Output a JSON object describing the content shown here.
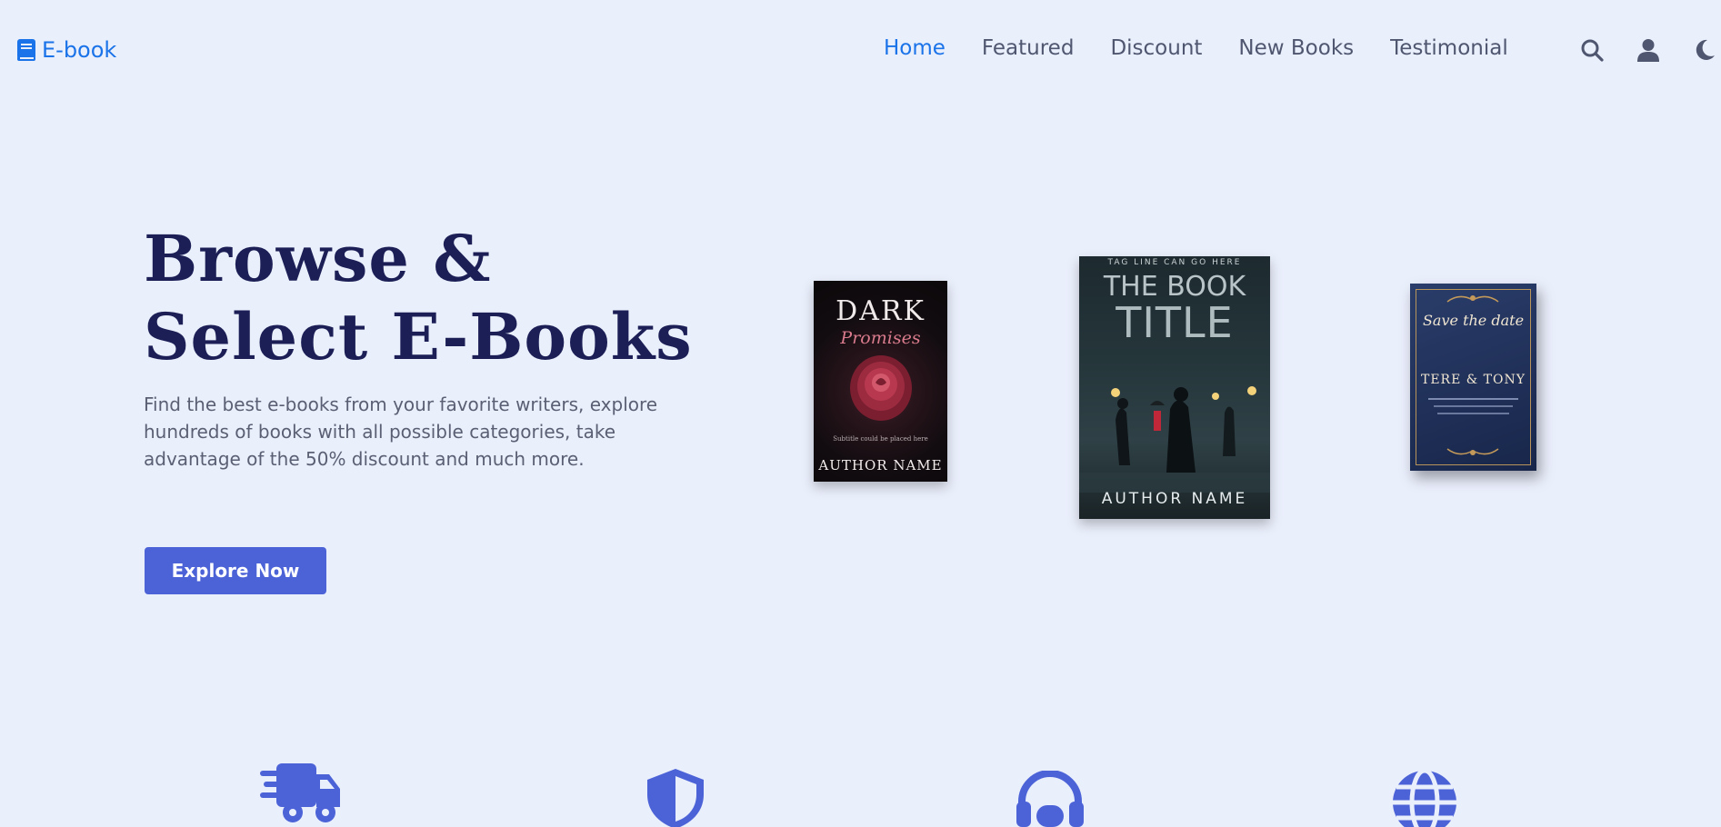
{
  "app": {
    "logo_text": "E-book"
  },
  "nav": {
    "items": [
      {
        "label": "Home",
        "active": true
      },
      {
        "label": "Featured",
        "active": false
      },
      {
        "label": "Discount",
        "active": false
      },
      {
        "label": "New Books",
        "active": false
      },
      {
        "label": "Testimonial",
        "active": false
      }
    ]
  },
  "header_icons": [
    "search-icon",
    "user-icon",
    "moon-icon"
  ],
  "hero": {
    "title_line1": "Browse &",
    "title_line2": "Select E-Books",
    "description": "Find the best e-books from your favorite writers, explore hundreds of books with all possible categories, take advantage of the 50% discount and much more.",
    "button_label": "Explore Now"
  },
  "books": [
    {
      "title": "DARK",
      "subtitle": "Promises",
      "tagline": "Subtitle could be placed here",
      "author": "AUTHOR NAME"
    },
    {
      "tagline": "TAG LINE CAN GO HERE",
      "title_top": "THE BOOK",
      "title_bottom": "TITLE",
      "author": "AUTHOR NAME"
    },
    {
      "script": "Save the date",
      "names": "TERE & TONY"
    }
  ],
  "features": [
    "truck-icon",
    "shield-icon",
    "headset-icon",
    "globe-icon"
  ],
  "colors": {
    "background": "#eaeffc",
    "accent": "#1a73e8",
    "heading": "#1b1f56",
    "button": "#4c63d8",
    "feature_icons": "#4c63d8",
    "nav_text": "#4f5770"
  }
}
